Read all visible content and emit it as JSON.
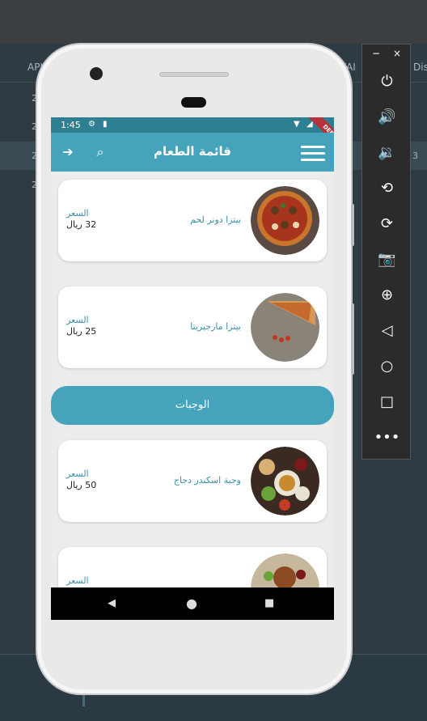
{
  "ide": {
    "columns": [
      "API",
      "/AI",
      "Dis"
    ],
    "rows": [
      {
        "c1": "2",
        "c3": ""
      },
      {
        "c1": "2",
        "c3": ""
      },
      {
        "c1": "2",
        "c3": "3"
      },
      {
        "c1": "2",
        "c3": ""
      }
    ]
  },
  "status": {
    "time": "1:45"
  },
  "appbar": {
    "title": "قائمة الطعام",
    "debug": "DEBUG"
  },
  "menu": {
    "cards": [
      {
        "name": "بيتزا دونر لحم",
        "price_label": "السعر",
        "price": "32 ريال"
      },
      {
        "name": "بيتزا مارجيريتا",
        "price_label": "السعر",
        "price": "25 ريال"
      }
    ],
    "section_label": "الوجبات",
    "meal_cards": [
      {
        "name": "وجبة اسكندر دجاج",
        "price_label": "السعر",
        "price": "50 ريال"
      },
      {
        "name": "",
        "price_label": "السعر",
        "price": ""
      }
    ]
  },
  "emulator": {
    "minimize": "−",
    "close": "×"
  }
}
